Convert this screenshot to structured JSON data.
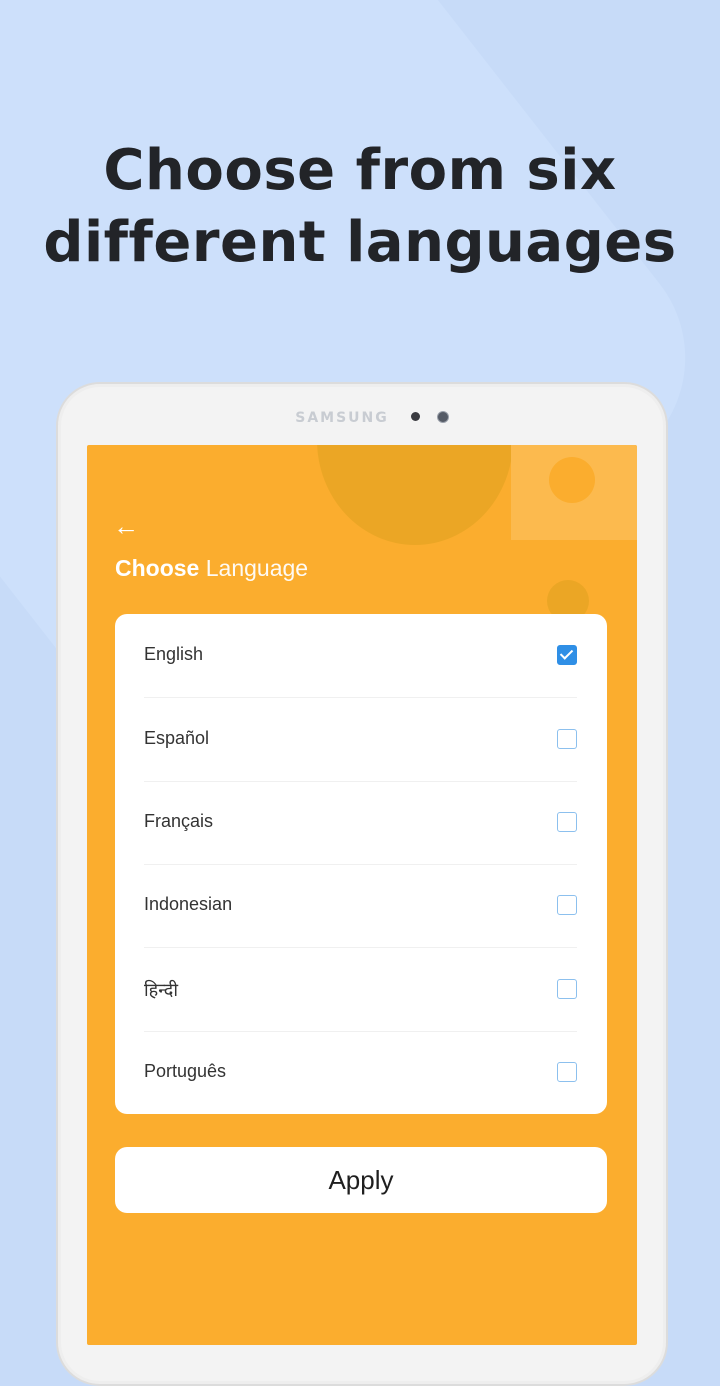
{
  "headline": {
    "line1": "Choose from six",
    "line2": "different languages"
  },
  "device": {
    "brand": "SAMSUNG"
  },
  "screen": {
    "back_icon": "←",
    "title_bold": "Choose",
    "title_light": "Language",
    "languages": [
      {
        "label": "English",
        "checked": true
      },
      {
        "label": "Español",
        "checked": false
      },
      {
        "label": "Français",
        "checked": false
      },
      {
        "label": "Indonesian",
        "checked": false
      },
      {
        "label": "हिन्दी",
        "checked": false
      },
      {
        "label": "Português",
        "checked": false
      }
    ],
    "apply_label": "Apply"
  },
  "colors": {
    "background": "#c7dbf8",
    "screen_accent": "#fbad2e",
    "checkbox_checked": "#2f8fe6",
    "checkbox_border": "#8cc0ee",
    "headline_text": "#222428"
  }
}
